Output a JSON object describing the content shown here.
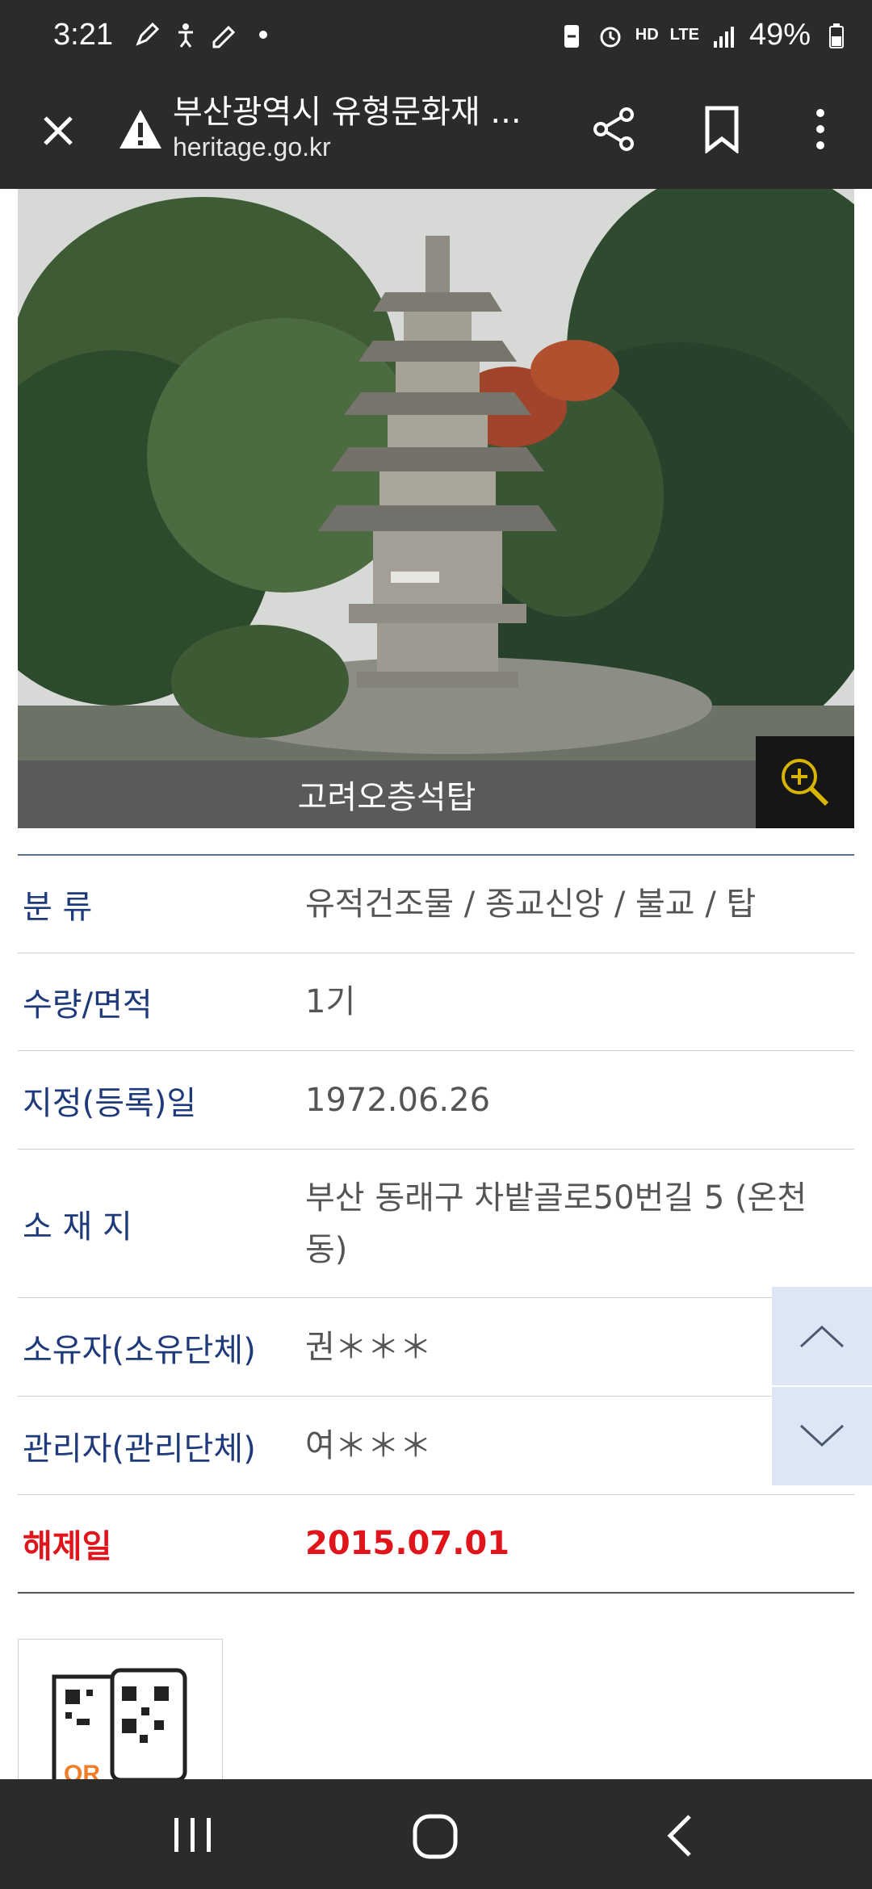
{
  "status_bar": {
    "time": "3:21",
    "battery": "49%",
    "network": "LTE",
    "hd_voice": "HD",
    "icons": [
      "edit-icon",
      "accessibility-icon",
      "pencil-icon",
      "dot-icon",
      "battery-saver-icon",
      "alarm-icon",
      "hd-voice-icon",
      "lte-icon",
      "signal-icon",
      "battery-icon"
    ]
  },
  "browser": {
    "page_title": "부산광역시 유형문화재 ...",
    "url": "heritage.go.kr",
    "icons": [
      "close-icon",
      "warning-icon",
      "share-icon",
      "bookmark-icon",
      "more-icon"
    ]
  },
  "photo": {
    "caption": "고려오층석탑",
    "zoom_icon": "zoom-in-icon"
  },
  "info": {
    "rows": [
      {
        "label": "분 류",
        "value": "유적건조물 / 종교신앙 / 불교 / 탑"
      },
      {
        "label": "수량/면적",
        "value": "1기"
      },
      {
        "label": "지정(등록)일",
        "value": "1972.06.26"
      },
      {
        "label": "소 재 지",
        "value": "부산 동래구 차밭골로50번길 5 (온천동)"
      },
      {
        "label": "소유자(소유단체)",
        "value": "권＊＊＊"
      },
      {
        "label": "관리자(관리단체)",
        "value": "여＊＊＊"
      },
      {
        "label": "해제일",
        "value": "2015.07.01"
      }
    ]
  },
  "qr": {
    "label": "QR"
  },
  "colors": {
    "label_blue": "#1f3a7a",
    "alert_red": "#e0141b",
    "bar_dark": "#2b2b2b",
    "scroll_btn": "#dde6f4"
  }
}
